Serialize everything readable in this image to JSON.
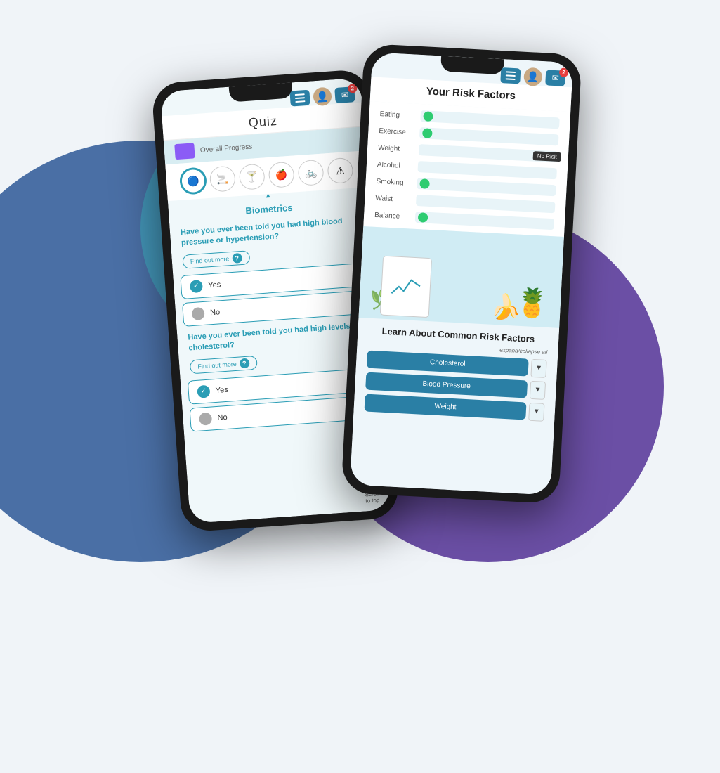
{
  "background": {
    "colors": {
      "blue_circle": "#4a6fa5",
      "purple_circle": "#6b4fa5",
      "teal_circle": "#3ab8c5"
    }
  },
  "left_phone": {
    "header": {
      "menu_icon": "hamburger",
      "avatar_icon": "user-avatar",
      "mail_icon": "mail",
      "notification_count": "2"
    },
    "screen": {
      "quiz_title": "Quiz",
      "progress_label": "Overall Progress",
      "categories": [
        "fingerprint",
        "smoke",
        "drink",
        "apple",
        "bicycle",
        "warning"
      ],
      "section_title": "Biometrics",
      "question_1": "Have you ever been told you had high blood pressure or hypertension?",
      "find_out_more_1": "Find out more",
      "answers_q1": [
        {
          "label": "Yes",
          "selected": true
        },
        {
          "label": "No",
          "selected": false
        }
      ],
      "question_2": "Have you ever been told you had high levels of cholesterol?",
      "find_out_more_2": "Find out more",
      "answers_q2": [
        {
          "label": "Yes",
          "selected": true
        },
        {
          "label": "No",
          "selected": false
        }
      ],
      "scroll_to_top": "Scroll\nto top"
    }
  },
  "right_phone": {
    "header": {
      "menu_icon": "hamburger",
      "avatar_icon": "user-avatar",
      "mail_icon": "mail",
      "notification_count": "2"
    },
    "screen": {
      "risk_title": "Your Risk Factors",
      "risk_factors": [
        {
          "label": "Eating",
          "has_dot": true,
          "dot_color": "#2ecc71"
        },
        {
          "label": "Exercise",
          "has_dot": true,
          "dot_color": "#2ecc71"
        },
        {
          "label": "Weight",
          "has_dot": false,
          "badge": "No Risk"
        },
        {
          "label": "Alcohol",
          "has_dot": false
        },
        {
          "label": "Smoking",
          "has_dot": true,
          "dot_color": "#2ecc71"
        },
        {
          "label": "Waist",
          "has_dot": false
        },
        {
          "label": "Balance",
          "has_dot": true,
          "dot_color": "#2ecc71"
        }
      ],
      "learn_title": "Learn About Common Risk Factors",
      "expand_collapse": "expand/collapse all",
      "accordion_items": [
        {
          "label": "Cholesterol"
        },
        {
          "label": "Blood Pressure"
        },
        {
          "label": "Weight"
        }
      ]
    }
  }
}
